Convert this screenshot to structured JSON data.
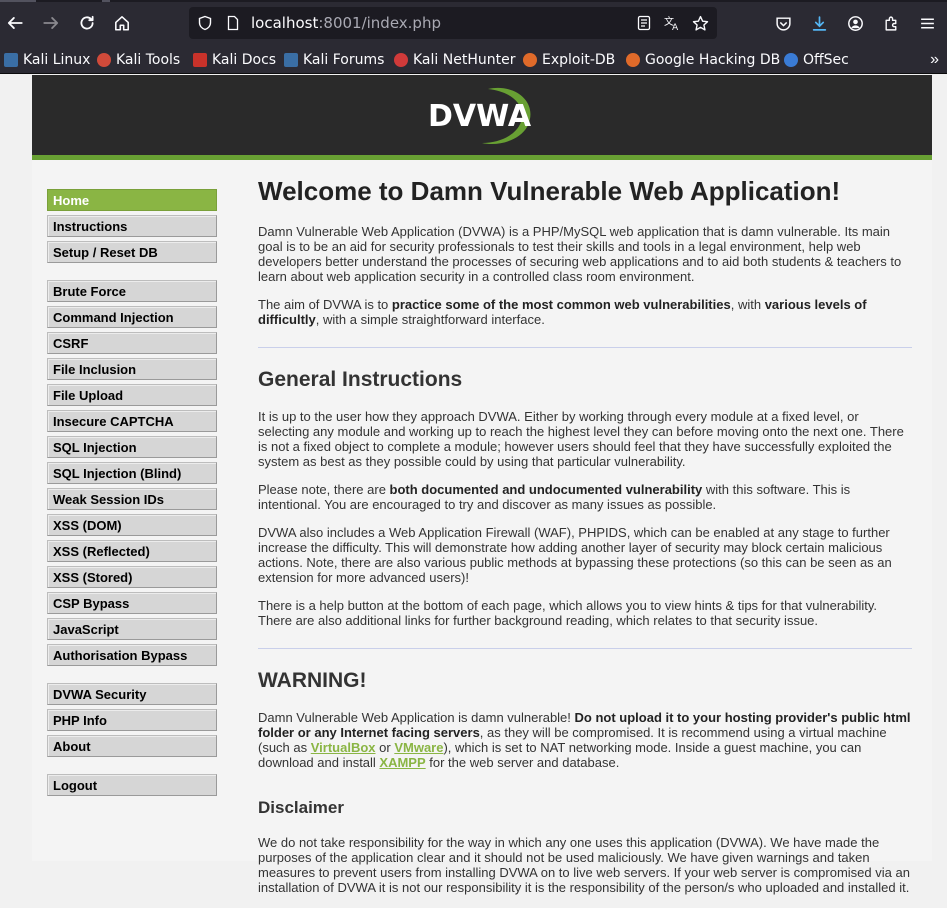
{
  "browser": {
    "url_host": "localhost",
    "url_rest": ":8001/index.php",
    "bookmarks": [
      {
        "label": "Kali Linux",
        "icon": "kali-dragon-icon",
        "color": "#3a6ea5"
      },
      {
        "label": "Kali Tools",
        "icon": "kali-tools-icon",
        "color": "#d04a3a"
      },
      {
        "label": "Kali Docs",
        "icon": "kali-docs-icon",
        "color": "#c8322a"
      },
      {
        "label": "Kali Forums",
        "icon": "kali-dragon-icon",
        "color": "#3a6ea5"
      },
      {
        "label": "Kali NetHunter",
        "icon": "nethunter-icon",
        "color": "#d03a3a"
      },
      {
        "label": "Exploit-DB",
        "icon": "exploit-db-icon",
        "color": "#e06a2a"
      },
      {
        "label": "Google Hacking DB",
        "icon": "ghdb-icon",
        "color": "#e06a2a"
      },
      {
        "label": "OffSec",
        "icon": "offsec-icon",
        "color": "#3a7bd5"
      }
    ]
  },
  "header": {
    "logo_text": "DVWA"
  },
  "menu": {
    "block1": [
      "Home",
      "Instructions",
      "Setup / Reset DB"
    ],
    "block2": [
      "Brute Force",
      "Command Injection",
      "CSRF",
      "File Inclusion",
      "File Upload",
      "Insecure CAPTCHA",
      "SQL Injection",
      "SQL Injection (Blind)",
      "Weak Session IDs",
      "XSS (DOM)",
      "XSS (Reflected)",
      "XSS (Stored)",
      "CSP Bypass",
      "JavaScript",
      "Authorisation Bypass"
    ],
    "block3": [
      "DVWA Security",
      "PHP Info",
      "About"
    ],
    "block4": [
      "Logout"
    ],
    "selected": "Home"
  },
  "main": {
    "title": "Welcome to Damn Vulnerable Web Application!",
    "intro": "Damn Vulnerable Web Application (DVWA) is a PHP/MySQL web application that is damn vulnerable. Its main goal is to be an aid for security professionals to test their skills and tools in a legal environment, help web developers better understand the processes of securing web applications and to aid both students & teachers to learn about web application security in a controlled class room environment.",
    "aim_pre": "The aim of DVWA is to ",
    "aim_b1": "practice some of the most common web vulnerabilities",
    "aim_mid": ", with ",
    "aim_b2": "various levels of difficultly",
    "aim_post": ", with a simple straightforward interface.",
    "gi_title": "General Instructions",
    "gi_p1": "It is up to the user how they approach DVWA. Either by working through every module at a fixed level, or selecting any module and working up to reach the highest level they can before moving onto the next one. There is not a fixed object to complete a module; however users should feel that they have successfully exploited the system as best as they possible could by using that particular vulnerability.",
    "gi_p2_pre": "Please note, there are ",
    "gi_p2_b": "both documented and undocumented vulnerability",
    "gi_p2_post": " with this software. This is intentional. You are encouraged to try and discover as many issues as possible.",
    "gi_p3": "DVWA also includes a Web Application Firewall (WAF), PHPIDS, which can be enabled at any stage to further increase the difficulty. This will demonstrate how adding another layer of security may block certain malicious actions. Note, there are also various public methods at bypassing these protections (so this can be seen as an extension for more advanced users)!",
    "gi_p4": "There is a help button at the bottom of each page, which allows you to view hints & tips for that vulnerability. There are also additional links for further background reading, which relates to that security issue.",
    "warn_title": "WARNING!",
    "warn_pre": "Damn Vulnerable Web Application is damn vulnerable! ",
    "warn_b": "Do not upload it to your hosting provider's public html folder or any Internet facing servers",
    "warn_mid1": ", as they will be compromised. It is recommend using a virtual machine (such as ",
    "warn_link1": "VirtualBox",
    "warn_or": " or ",
    "warn_link2": "VMware",
    "warn_mid2": "), which is set to NAT networking mode. Inside a guest machine, you can download and install ",
    "warn_link3": "XAMPP",
    "warn_post": " for the web server and database.",
    "disc_title": "Disclaimer",
    "disc_p": "We do not take responsibility for the way in which any one uses this application (DVWA). We have made the purposes of the application clear and it should not be used maliciously. We have given warnings and taken measures to prevent users from installing DVWA on to live web servers. If your web server is compromised via an installation of DVWA it is not our responsibility it is the responsibility of the person/s who uploaded and installed it."
  }
}
